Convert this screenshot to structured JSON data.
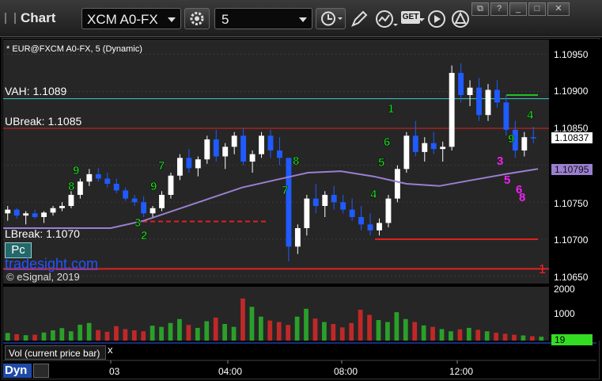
{
  "app": {
    "title": "Chart"
  },
  "toolbar": {
    "symbol": "XCM A0-FX",
    "interval": "5",
    "get_label": "GET"
  },
  "window": {
    "restore_label": "□",
    "close_label": "✕"
  },
  "study_title": "* EUR@FXCM A0-FX, 5 (Dynamic)",
  "levels": {
    "vah": {
      "label": "VAH: 1.1089",
      "value": 1.1089
    },
    "ubreak": {
      "label": "UBreak: 1.1085",
      "value": 1.1085
    },
    "lbreak": {
      "label": "LBreak: 1.1070",
      "value": 1.107
    },
    "low_line": {
      "value": 1.1066,
      "marker": "1"
    }
  },
  "price_axis": {
    "ticks": [
      "1.10950",
      "1.10900",
      "1.10850",
      "1.10750",
      "1.10700",
      "1.10650"
    ],
    "last_price": "1.10837",
    "ma_value": "1.10795"
  },
  "watermark": {
    "brand": "tradesight.com",
    "copyright": "© eSignal, 2019",
    "pc_label": "Pc"
  },
  "volume": {
    "label": "Vol (current price bar)",
    "close_glyph": "x",
    "ticks": [
      "2000",
      "1000"
    ],
    "current": "19"
  },
  "time_axis": {
    "labels": [
      "03",
      "04:00",
      "08:00",
      "12:00"
    ]
  },
  "footer": {
    "dyn_label": "Dyn"
  },
  "markers": {
    "green": [
      "9",
      "8",
      "7",
      "9",
      "8",
      "7",
      "6",
      "5",
      "4",
      "3",
      "2",
      "1",
      "9",
      "4"
    ],
    "magenta": [
      "3",
      "5",
      "6",
      "8"
    ]
  },
  "colors": {
    "background": "#000000",
    "up_candle": "#ffffff",
    "down_candle": "#1f5bff",
    "vah": "#3ec9c9",
    "ubreak": "#e02020",
    "lbreak": "#e02020",
    "ma": "#9a7fd0",
    "volume_up": "#2aa02a",
    "volume_down": "#c02828",
    "setup_green": "#22dd22",
    "setup_magenta": "#ee22ee"
  },
  "chart_data": {
    "type": "candlestick",
    "x_start": "02:00",
    "x_interval_minutes": 5,
    "ylim": [
      1.1064,
      1.1097
    ],
    "candles": [
      [
        1.10735,
        1.10745,
        1.10725,
        1.1074
      ],
      [
        1.1074,
        1.10742,
        1.10728,
        1.10732
      ],
      [
        1.10732,
        1.10738,
        1.1072,
        1.10735
      ],
      [
        1.10735,
        1.1074,
        1.10728,
        1.1073
      ],
      [
        1.1073,
        1.10738,
        1.10722,
        1.10736
      ],
      [
        1.10736,
        1.10745,
        1.10732,
        1.10742
      ],
      [
        1.10742,
        1.1075,
        1.10738,
        1.10745
      ],
      [
        1.10745,
        1.10765,
        1.10742,
        1.1076
      ],
      [
        1.1076,
        1.10782,
        1.10755,
        1.10778
      ],
      [
        1.10778,
        1.10795,
        1.10772,
        1.10788
      ],
      [
        1.10788,
        1.10796,
        1.10778,
        1.10782
      ],
      [
        1.10782,
        1.1079,
        1.1077,
        1.10775
      ],
      [
        1.10775,
        1.10782,
        1.10762,
        1.10766
      ],
      [
        1.10766,
        1.1077,
        1.10752,
        1.10755
      ],
      [
        1.10755,
        1.1076,
        1.10745,
        1.1075
      ],
      [
        1.1075,
        1.10758,
        1.1073,
        1.10735
      ],
      [
        1.10735,
        1.10745,
        1.10728,
        1.10742
      ],
      [
        1.10742,
        1.10765,
        1.10738,
        1.1076
      ],
      [
        1.1076,
        1.1079,
        1.10755,
        1.10786
      ],
      [
        1.10786,
        1.10815,
        1.1078,
        1.1081
      ],
      [
        1.1081,
        1.10822,
        1.1079,
        1.10796
      ],
      [
        1.10796,
        1.10812,
        1.10785,
        1.10808
      ],
      [
        1.10808,
        1.1084,
        1.10802,
        1.10835
      ],
      [
        1.10835,
        1.10848,
        1.10805,
        1.10812
      ],
      [
        1.10812,
        1.1083,
        1.10795,
        1.10825
      ],
      [
        1.10825,
        1.10845,
        1.10815,
        1.1084
      ],
      [
        1.1084,
        1.1085,
        1.108,
        1.10805
      ],
      [
        1.10805,
        1.1082,
        1.1079,
        1.10815
      ],
      [
        1.10815,
        1.10845,
        1.1081,
        1.1084
      ],
      [
        1.1084,
        1.10848,
        1.1081,
        1.1082
      ],
      [
        1.1082,
        1.10838,
        1.108,
        1.1081
      ],
      [
        1.1081,
        1.1076,
        1.1067,
        1.1069
      ],
      [
        1.1069,
        1.1072,
        1.1068,
        1.10715
      ],
      [
        1.10715,
        1.1076,
        1.10705,
        1.10755
      ],
      [
        1.10755,
        1.10775,
        1.10735,
        1.10745
      ],
      [
        1.10745,
        1.10765,
        1.1073,
        1.1076
      ],
      [
        1.1076,
        1.10772,
        1.1074,
        1.1075
      ],
      [
        1.1075,
        1.1076,
        1.10735,
        1.1074
      ],
      [
        1.1074,
        1.10755,
        1.10725,
        1.1073
      ],
      [
        1.1073,
        1.10745,
        1.10712,
        1.1072
      ],
      [
        1.1072,
        1.10735,
        1.10705,
        1.10712
      ],
      [
        1.10712,
        1.10728,
        1.10705,
        1.10722
      ],
      [
        1.10722,
        1.1076,
        1.10716,
        1.10755
      ],
      [
        1.10755,
        1.108,
        1.1075,
        1.10795
      ],
      [
        1.10795,
        1.10845,
        1.1079,
        1.1084
      ],
      [
        1.1084,
        1.1086,
        1.10812,
        1.10818
      ],
      [
        1.10818,
        1.10838,
        1.10805,
        1.1083
      ],
      [
        1.1083,
        1.10845,
        1.10815,
        1.10822
      ],
      [
        1.10822,
        1.10832,
        1.10805,
        1.10825
      ],
      [
        1.10825,
        1.10935,
        1.1082,
        1.10925
      ],
      [
        1.10925,
        1.10938,
        1.10885,
        1.10895
      ],
      [
        1.10895,
        1.10915,
        1.1088,
        1.10905
      ],
      [
        1.10905,
        1.10918,
        1.1086,
        1.10868
      ],
      [
        1.10868,
        1.1091,
        1.1086,
        1.10902
      ],
      [
        1.10902,
        1.10915,
        1.10878,
        1.10885
      ],
      [
        1.10885,
        1.10895,
        1.1084,
        1.10848
      ],
      [
        1.10848,
        1.1086,
        1.1081,
        1.1082
      ],
      [
        1.1082,
        1.10845,
        1.10812,
        1.10838
      ],
      [
        1.10838,
        1.10852,
        1.1083,
        1.10837
      ]
    ],
    "moving_average": [
      1.10715,
      1.10725,
      1.1074,
      1.10755,
      1.1077,
      1.1078,
      1.1079,
      1.10792,
      1.10785,
      1.10775,
      1.10772,
      1.1078,
      1.10788,
      1.10795
    ],
    "volume_ylim": [
      0,
      2200
    ],
    "volume": [
      310,
      260,
      220,
      240,
      330,
      420,
      510,
      380,
      650,
      720,
      430,
      360,
      590,
      470,
      420,
      380,
      610,
      560,
      720,
      880,
      640,
      520,
      790,
      940,
      680,
      560,
      1720,
      1380,
      980,
      820,
      760,
      640,
      980,
      1300,
      900,
      760,
      680,
      540,
      720,
      1260,
      1050,
      840,
      760,
      1160,
      880,
      760,
      620,
      560,
      470,
      380,
      460,
      520,
      440,
      380,
      320,
      280,
      240,
      210,
      180,
      160
    ]
  }
}
